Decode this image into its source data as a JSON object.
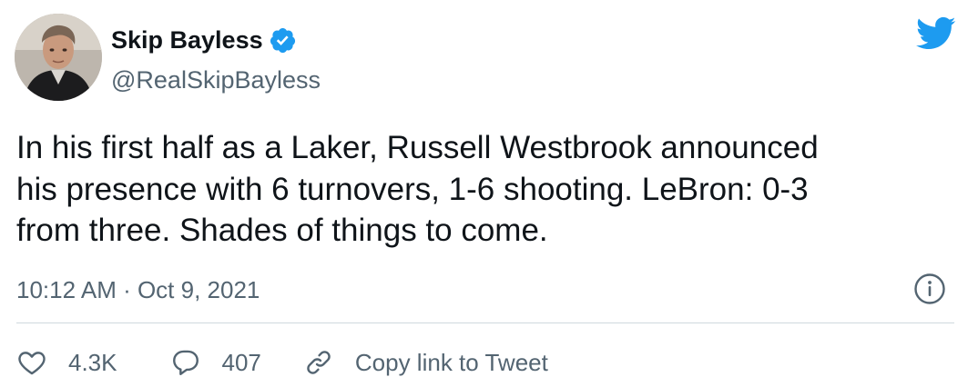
{
  "user": {
    "display_name": "Skip Bayless",
    "handle": "@RealSkipBayless",
    "verified": true,
    "avatar_icon": "profile-photo"
  },
  "tweet": {
    "text_lines": [
      "In his first half as a Laker, Russell Westbrook announced",
      "his presence with 6 turnovers, 1-6 shooting. LeBron: 0-3",
      "from three. Shades of things to come."
    ],
    "timestamp": "10:12 AM · Oct 9, 2021"
  },
  "actions": {
    "like_count": "4.3K",
    "reply_count": "407",
    "copy_link_label": "Copy link to Tweet"
  },
  "icons": {
    "brand": "twitter-bird-icon",
    "verified": "verified-badge-icon",
    "info": "info-icon",
    "like": "heart-icon",
    "reply": "speech-bubble-icon",
    "link": "link-icon"
  },
  "colors": {
    "brand_blue": "#1d9bf0",
    "text_primary": "#0f1419",
    "text_secondary": "#536471",
    "divider": "#cfd9de"
  }
}
